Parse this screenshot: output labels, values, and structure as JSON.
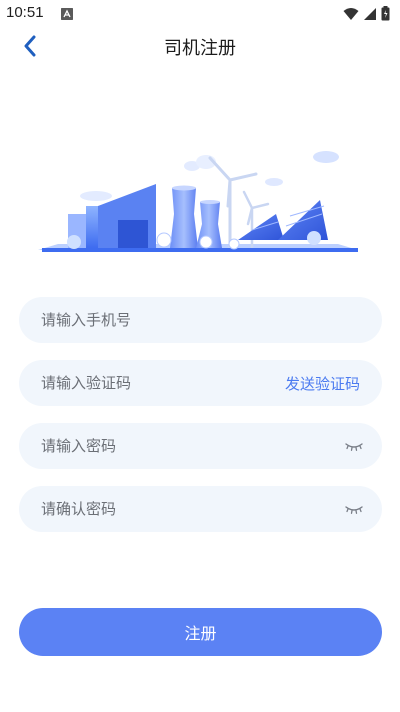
{
  "status_bar": {
    "time": "10:51",
    "icons": [
      "notification-icon",
      "wifi-icon",
      "signal-icon",
      "battery-icon"
    ]
  },
  "header": {
    "title": "司机注册",
    "back_icon": "chevron-left-icon"
  },
  "hero": {
    "icon": "power-plant-illustration"
  },
  "form": {
    "phone_placeholder": "请输入手机号",
    "code_placeholder": "请输入验证码",
    "send_code_label": "发送验证码",
    "password_placeholder": "请输入密码",
    "confirm_password_placeholder": "请确认密码",
    "eye_icon": "eye-closed-icon"
  },
  "submit_label": "注册",
  "colors": {
    "accent": "#5b82f4",
    "link": "#4b7bf0",
    "field_bg": "#f1f6fc",
    "back_arrow": "#1f5fbf"
  }
}
